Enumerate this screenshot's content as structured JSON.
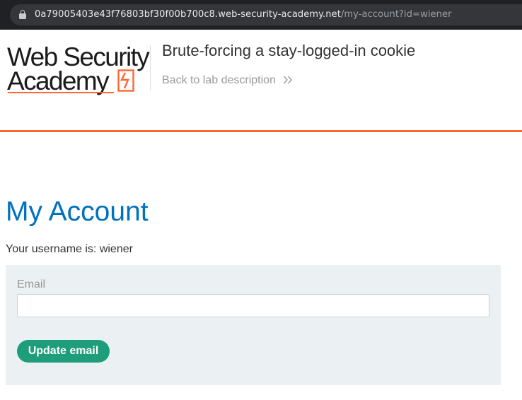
{
  "browser": {
    "url_host": "0a79005403e43f76803bf30f00b700c8.web-security-academy.net",
    "url_path": "/my-account?id=wiener"
  },
  "header": {
    "logo_line1": "Web Security",
    "logo_line2": "Academy",
    "lab_title": "Brute-forcing a stay-logged-in cookie",
    "back_link": "Back to lab description",
    "accent_color": "#ff6633"
  },
  "main": {
    "title": "My Account",
    "username_text": "Your username is: wiener",
    "form": {
      "email_label": "Email",
      "email_value": "",
      "update_button": "Update email",
      "button_color": "#1d9d7a"
    }
  }
}
